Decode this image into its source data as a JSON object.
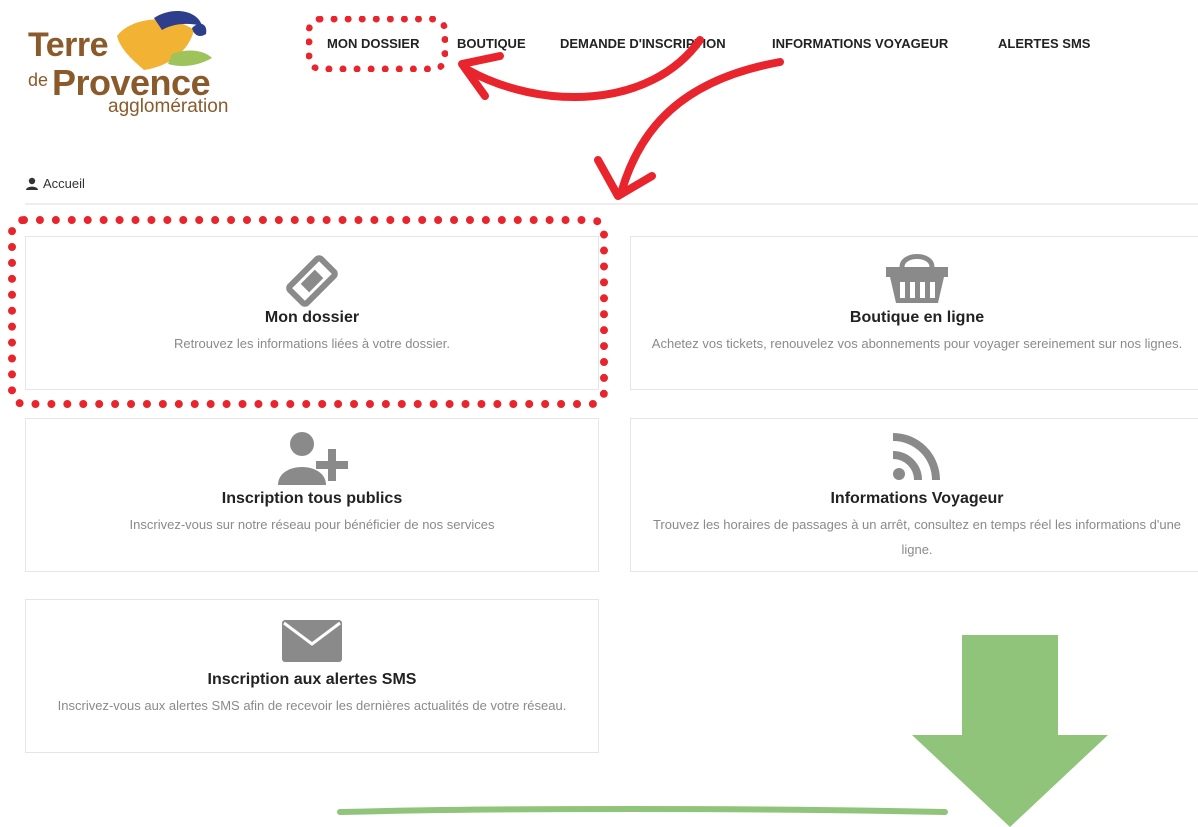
{
  "logo": {
    "line1": "Terre",
    "line2_prefix": "de",
    "line2": "Provence",
    "line3": "agglomération"
  },
  "nav": {
    "items": [
      {
        "label": "MON DOSSIER"
      },
      {
        "label": "BOUTIQUE"
      },
      {
        "label": "DEMANDE D'INSCRIPTION"
      },
      {
        "label": "INFORMATIONS VOYAGEUR"
      },
      {
        "label": "ALERTES SMS"
      }
    ]
  },
  "breadcrumb": {
    "icon": "user-icon",
    "label": "Accueil"
  },
  "cards": [
    {
      "icon": "ticket-icon",
      "title": "Mon dossier",
      "desc": "Retrouvez les informations liées à votre dossier."
    },
    {
      "icon": "basket-icon",
      "title": "Boutique en ligne",
      "desc": "Achetez vos tickets, renouvelez vos abonnements pour voyager sereinement sur nos lignes."
    },
    {
      "icon": "user-plus-icon",
      "title": "Inscription tous publics",
      "desc": "Inscrivez-vous sur notre réseau pour bénéficier de nos services"
    },
    {
      "icon": "rss-icon",
      "title": "Informations Voyageur",
      "desc": "Trouvez les horaires de passages à un arrêt, consultez en temps réel les informations d'une ligne."
    },
    {
      "icon": "envelope-icon",
      "title": "Inscription aux alertes SMS",
      "desc": "Inscrivez-vous aux alertes SMS afin de recevoir les dernières actualités de votre réseau."
    }
  ],
  "colors": {
    "annotation_red": "#e8242c",
    "arrow_green": "#8fc47a",
    "icon_gray": "#8a8a8a",
    "logo_brown": "#8b5a2b"
  }
}
